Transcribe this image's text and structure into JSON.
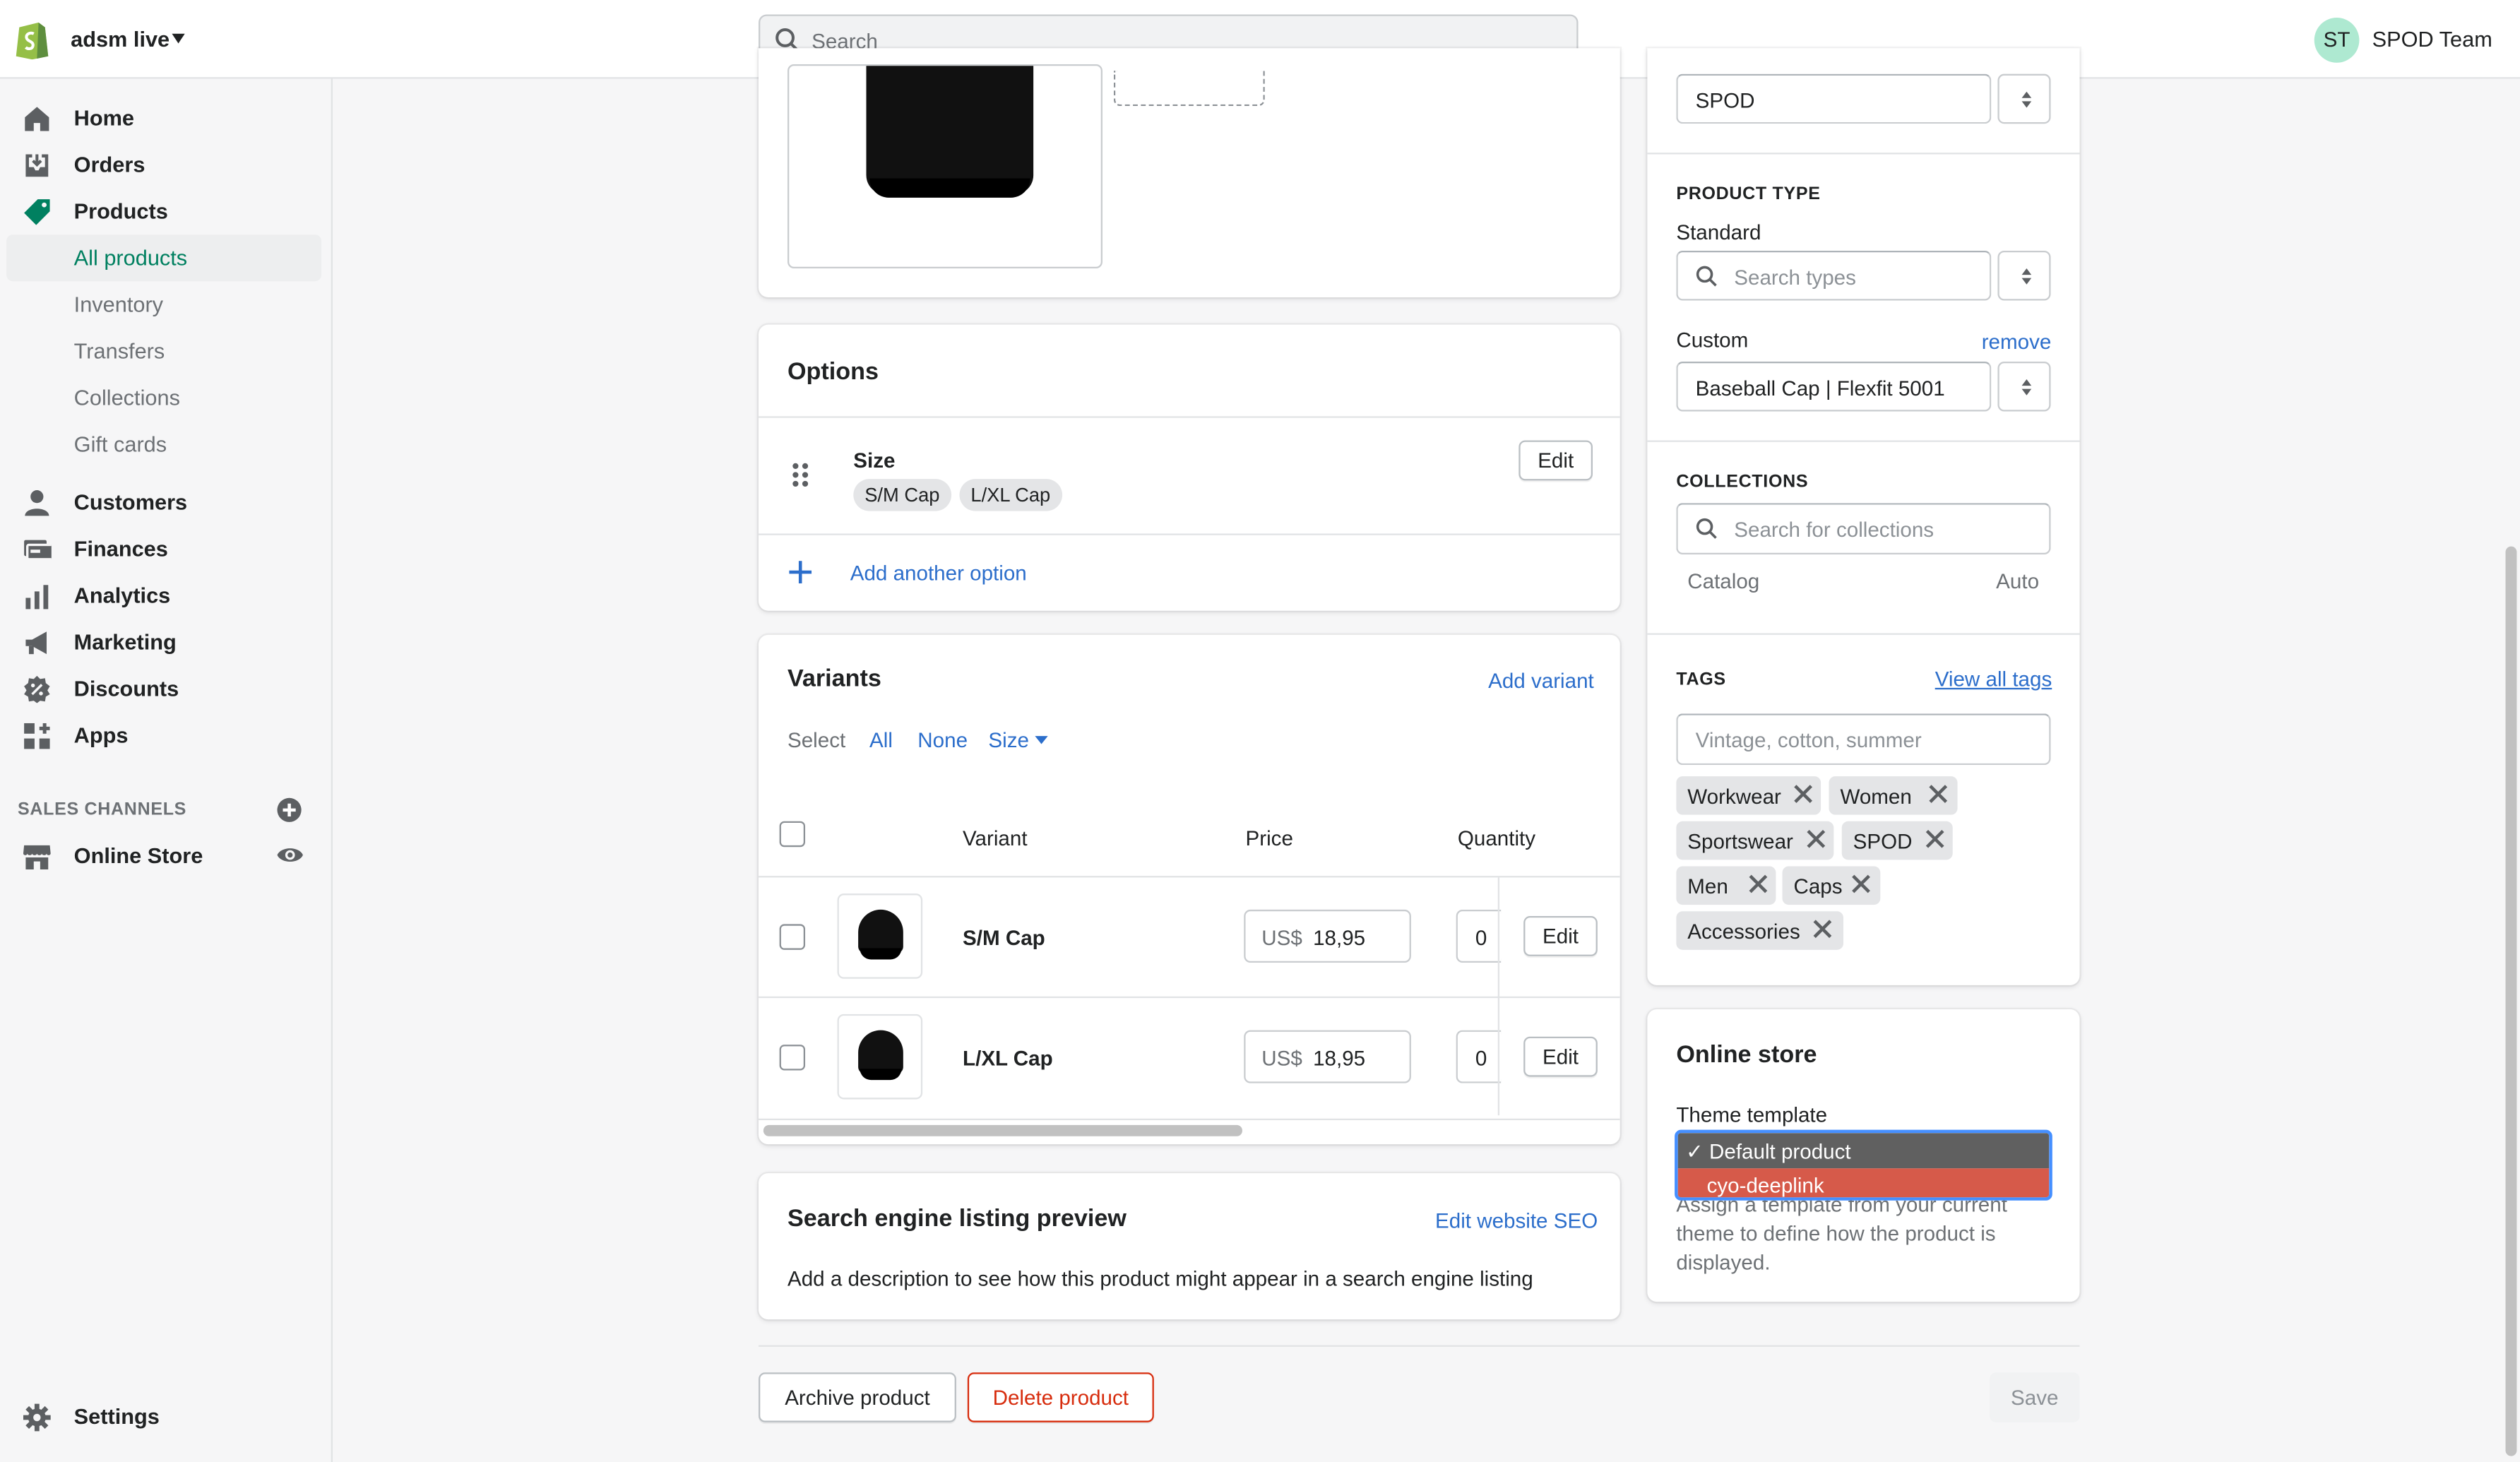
{
  "topbar": {
    "store_name": "adsm live",
    "search_placeholder": "Search",
    "avatar_initials": "ST",
    "user_name": "SPOD Team"
  },
  "sidebar": {
    "home": "Home",
    "orders": "Orders",
    "products": "Products",
    "all_products": "All products",
    "inventory": "Inventory",
    "transfers": "Transfers",
    "collections": "Collections",
    "gift_cards": "Gift cards",
    "customers": "Customers",
    "finances": "Finances",
    "analytics": "Analytics",
    "marketing": "Marketing",
    "discounts": "Discounts",
    "apps": "Apps",
    "sales_channels_label": "SALES CHANNELS",
    "online_store": "Online Store",
    "settings": "Settings"
  },
  "options": {
    "title": "Options",
    "option_name": "Size",
    "values": [
      "S/M Cap",
      "L/XL Cap"
    ],
    "edit_label": "Edit",
    "add_option_label": "Add another option"
  },
  "variants": {
    "title": "Variants",
    "add_variant_label": "Add variant",
    "select_label": "Select",
    "select_all": "All",
    "select_none": "None",
    "select_size": "Size",
    "columns": [
      "Variant",
      "Price",
      "Quantity"
    ],
    "rows": [
      {
        "name": "S/M Cap",
        "currency": "US$",
        "price": "18,95",
        "quantity": "0",
        "edit": "Edit"
      },
      {
        "name": "L/XL Cap",
        "currency": "US$",
        "price": "18,95",
        "quantity": "0",
        "edit": "Edit"
      }
    ]
  },
  "seo": {
    "title": "Search engine listing preview",
    "edit_label": "Edit website SEO",
    "description": "Add a description to see how this product might appear in a search engine listing"
  },
  "footer": {
    "archive_label": "Archive product",
    "delete_label": "Delete product",
    "save_label": "Save"
  },
  "organization": {
    "vendor_value": "SPOD",
    "product_type_label": "PRODUCT TYPE",
    "standard_label": "Standard",
    "standard_placeholder": "Search types",
    "custom_label": "Custom",
    "remove_label": "remove",
    "custom_value": "Baseball Cap | Flexfit 5001",
    "collections_label": "COLLECTIONS",
    "collections_placeholder": "Search for collections",
    "collection_name": "Catalog",
    "collection_type": "Auto",
    "tags_label": "TAGS",
    "view_all_tags": "View all tags",
    "tags_placeholder": "Vintage, cotton, summer",
    "tags": [
      "Workwear",
      "Women",
      "Sportswear",
      "SPOD",
      "Men",
      "Caps",
      "Accessories"
    ]
  },
  "online_store": {
    "title": "Online store",
    "theme_template_label": "Theme template",
    "options": [
      "✓ Default product",
      "cyo-deeplink"
    ],
    "help_text": "Assign a template from your current theme to define how the product is displayed."
  },
  "colors": {
    "accent_green": "#008060",
    "link_blue": "#2c6ecb",
    "danger_red": "#d72c0d",
    "dropdown_selected": "#606060",
    "dropdown_hover": "#d65a4a"
  }
}
